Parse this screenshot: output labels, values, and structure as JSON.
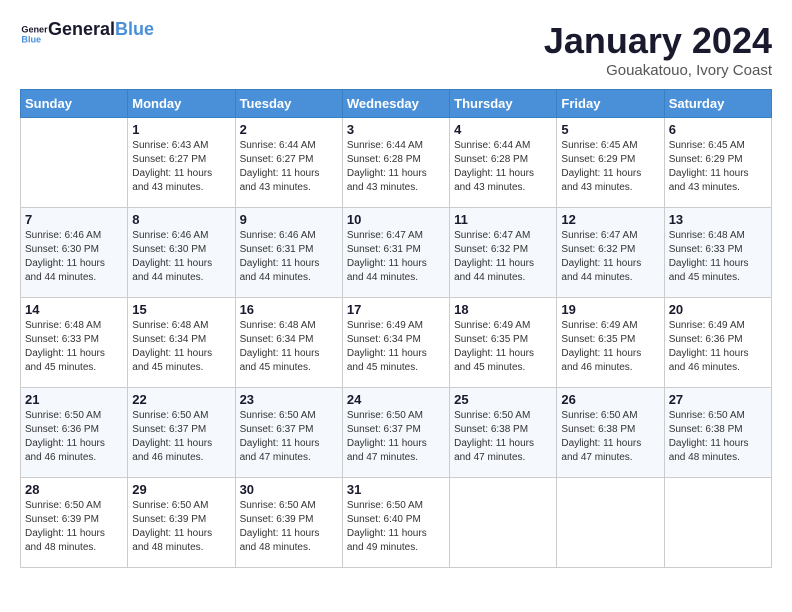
{
  "header": {
    "logo_line1": "General",
    "logo_line2": "Blue",
    "title": "January 2024",
    "subtitle": "Gouakatouo, Ivory Coast"
  },
  "weekdays": [
    "Sunday",
    "Monday",
    "Tuesday",
    "Wednesday",
    "Thursday",
    "Friday",
    "Saturday"
  ],
  "weeks": [
    [
      {
        "day": "",
        "sunrise": "",
        "sunset": "",
        "daylight": ""
      },
      {
        "day": "1",
        "sunrise": "Sunrise: 6:43 AM",
        "sunset": "Sunset: 6:27 PM",
        "daylight": "Daylight: 11 hours and 43 minutes."
      },
      {
        "day": "2",
        "sunrise": "Sunrise: 6:44 AM",
        "sunset": "Sunset: 6:27 PM",
        "daylight": "Daylight: 11 hours and 43 minutes."
      },
      {
        "day": "3",
        "sunrise": "Sunrise: 6:44 AM",
        "sunset": "Sunset: 6:28 PM",
        "daylight": "Daylight: 11 hours and 43 minutes."
      },
      {
        "day": "4",
        "sunrise": "Sunrise: 6:44 AM",
        "sunset": "Sunset: 6:28 PM",
        "daylight": "Daylight: 11 hours and 43 minutes."
      },
      {
        "day": "5",
        "sunrise": "Sunrise: 6:45 AM",
        "sunset": "Sunset: 6:29 PM",
        "daylight": "Daylight: 11 hours and 43 minutes."
      },
      {
        "day": "6",
        "sunrise": "Sunrise: 6:45 AM",
        "sunset": "Sunset: 6:29 PM",
        "daylight": "Daylight: 11 hours and 43 minutes."
      }
    ],
    [
      {
        "day": "7",
        "sunrise": "Sunrise: 6:46 AM",
        "sunset": "Sunset: 6:30 PM",
        "daylight": "Daylight: 11 hours and 44 minutes."
      },
      {
        "day": "8",
        "sunrise": "Sunrise: 6:46 AM",
        "sunset": "Sunset: 6:30 PM",
        "daylight": "Daylight: 11 hours and 44 minutes."
      },
      {
        "day": "9",
        "sunrise": "Sunrise: 6:46 AM",
        "sunset": "Sunset: 6:31 PM",
        "daylight": "Daylight: 11 hours and 44 minutes."
      },
      {
        "day": "10",
        "sunrise": "Sunrise: 6:47 AM",
        "sunset": "Sunset: 6:31 PM",
        "daylight": "Daylight: 11 hours and 44 minutes."
      },
      {
        "day": "11",
        "sunrise": "Sunrise: 6:47 AM",
        "sunset": "Sunset: 6:32 PM",
        "daylight": "Daylight: 11 hours and 44 minutes."
      },
      {
        "day": "12",
        "sunrise": "Sunrise: 6:47 AM",
        "sunset": "Sunset: 6:32 PM",
        "daylight": "Daylight: 11 hours and 44 minutes."
      },
      {
        "day": "13",
        "sunrise": "Sunrise: 6:48 AM",
        "sunset": "Sunset: 6:33 PM",
        "daylight": "Daylight: 11 hours and 45 minutes."
      }
    ],
    [
      {
        "day": "14",
        "sunrise": "Sunrise: 6:48 AM",
        "sunset": "Sunset: 6:33 PM",
        "daylight": "Daylight: 11 hours and 45 minutes."
      },
      {
        "day": "15",
        "sunrise": "Sunrise: 6:48 AM",
        "sunset": "Sunset: 6:34 PM",
        "daylight": "Daylight: 11 hours and 45 minutes."
      },
      {
        "day": "16",
        "sunrise": "Sunrise: 6:48 AM",
        "sunset": "Sunset: 6:34 PM",
        "daylight": "Daylight: 11 hours and 45 minutes."
      },
      {
        "day": "17",
        "sunrise": "Sunrise: 6:49 AM",
        "sunset": "Sunset: 6:34 PM",
        "daylight": "Daylight: 11 hours and 45 minutes."
      },
      {
        "day": "18",
        "sunrise": "Sunrise: 6:49 AM",
        "sunset": "Sunset: 6:35 PM",
        "daylight": "Daylight: 11 hours and 45 minutes."
      },
      {
        "day": "19",
        "sunrise": "Sunrise: 6:49 AM",
        "sunset": "Sunset: 6:35 PM",
        "daylight": "Daylight: 11 hours and 46 minutes."
      },
      {
        "day": "20",
        "sunrise": "Sunrise: 6:49 AM",
        "sunset": "Sunset: 6:36 PM",
        "daylight": "Daylight: 11 hours and 46 minutes."
      }
    ],
    [
      {
        "day": "21",
        "sunrise": "Sunrise: 6:50 AM",
        "sunset": "Sunset: 6:36 PM",
        "daylight": "Daylight: 11 hours and 46 minutes."
      },
      {
        "day": "22",
        "sunrise": "Sunrise: 6:50 AM",
        "sunset": "Sunset: 6:37 PM",
        "daylight": "Daylight: 11 hours and 46 minutes."
      },
      {
        "day": "23",
        "sunrise": "Sunrise: 6:50 AM",
        "sunset": "Sunset: 6:37 PM",
        "daylight": "Daylight: 11 hours and 47 minutes."
      },
      {
        "day": "24",
        "sunrise": "Sunrise: 6:50 AM",
        "sunset": "Sunset: 6:37 PM",
        "daylight": "Daylight: 11 hours and 47 minutes."
      },
      {
        "day": "25",
        "sunrise": "Sunrise: 6:50 AM",
        "sunset": "Sunset: 6:38 PM",
        "daylight": "Daylight: 11 hours and 47 minutes."
      },
      {
        "day": "26",
        "sunrise": "Sunrise: 6:50 AM",
        "sunset": "Sunset: 6:38 PM",
        "daylight": "Daylight: 11 hours and 47 minutes."
      },
      {
        "day": "27",
        "sunrise": "Sunrise: 6:50 AM",
        "sunset": "Sunset: 6:38 PM",
        "daylight": "Daylight: 11 hours and 48 minutes."
      }
    ],
    [
      {
        "day": "28",
        "sunrise": "Sunrise: 6:50 AM",
        "sunset": "Sunset: 6:39 PM",
        "daylight": "Daylight: 11 hours and 48 minutes."
      },
      {
        "day": "29",
        "sunrise": "Sunrise: 6:50 AM",
        "sunset": "Sunset: 6:39 PM",
        "daylight": "Daylight: 11 hours and 48 minutes."
      },
      {
        "day": "30",
        "sunrise": "Sunrise: 6:50 AM",
        "sunset": "Sunset: 6:39 PM",
        "daylight": "Daylight: 11 hours and 48 minutes."
      },
      {
        "day": "31",
        "sunrise": "Sunrise: 6:50 AM",
        "sunset": "Sunset: 6:40 PM",
        "daylight": "Daylight: 11 hours and 49 minutes."
      },
      {
        "day": "",
        "sunrise": "",
        "sunset": "",
        "daylight": ""
      },
      {
        "day": "",
        "sunrise": "",
        "sunset": "",
        "daylight": ""
      },
      {
        "day": "",
        "sunrise": "",
        "sunset": "",
        "daylight": ""
      }
    ]
  ]
}
